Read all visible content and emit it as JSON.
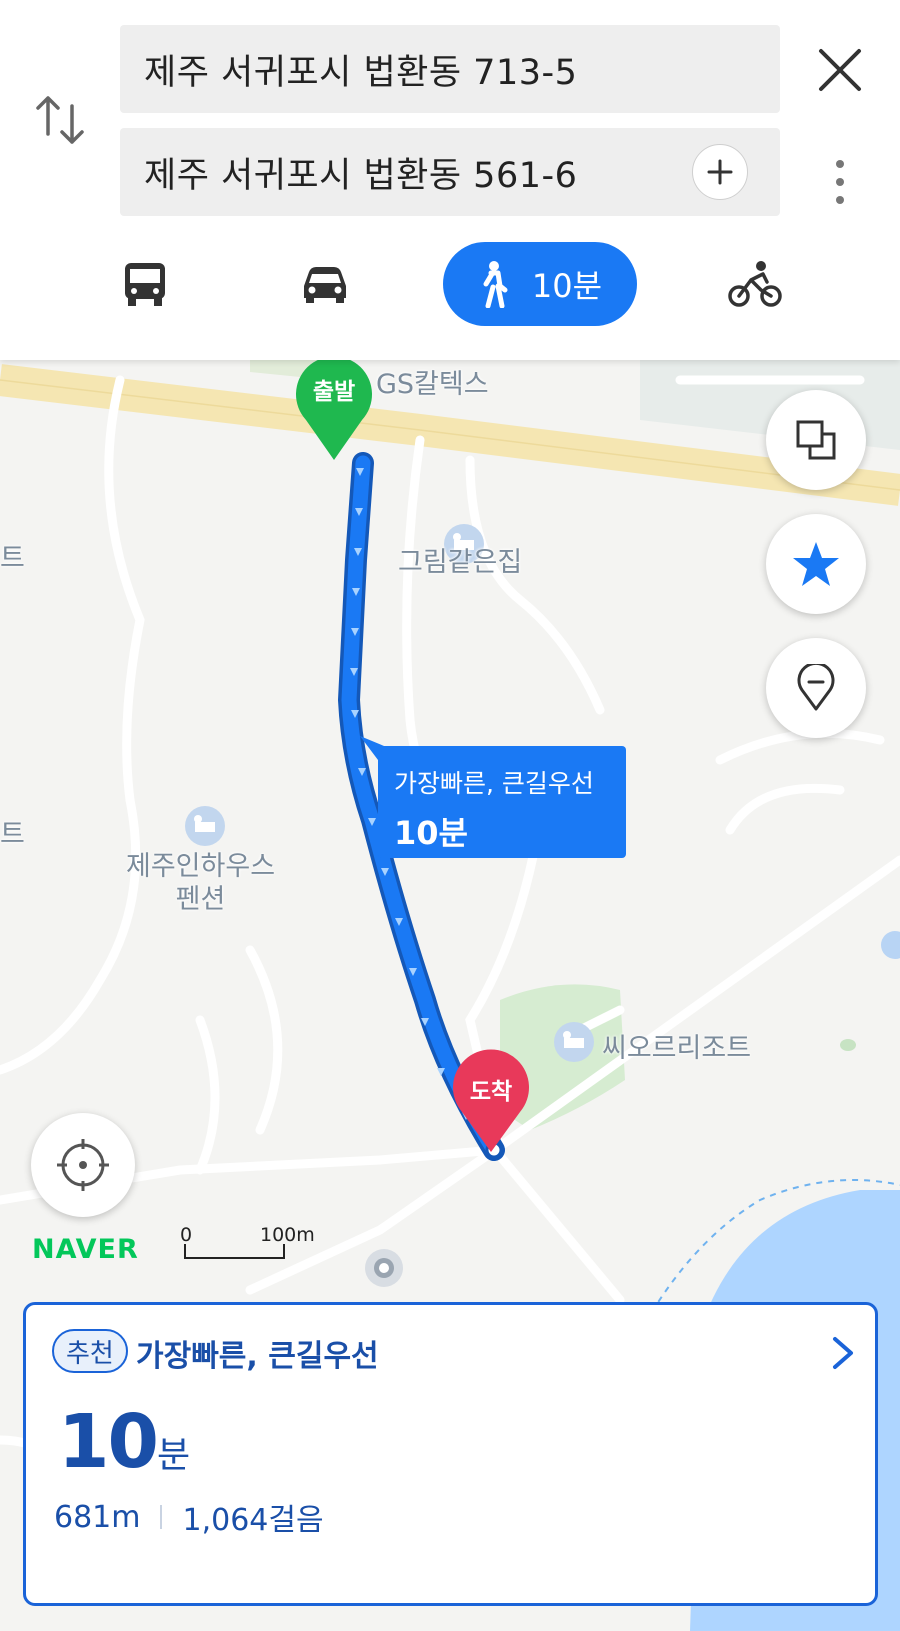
{
  "search": {
    "from_value": "제주 서귀포시 법환동 713-5",
    "to_value": "제주 서귀포시 법환동 561-6"
  },
  "modes": {
    "items": [
      "bus",
      "car",
      "walk",
      "bike"
    ],
    "selected": "walk",
    "walk_time": "10분"
  },
  "map": {
    "labels": {
      "gs": "GS칼텍스",
      "house": "그림같은집",
      "inn": "제주인하우스\n펜션",
      "resort": "씨오르리조트",
      "edge1": "트",
      "edge2": "트"
    },
    "start_marker": "출발",
    "end_marker": "도착",
    "route_bubble_title": "가장빠른, 큰길우선",
    "route_bubble_time": "10분",
    "logo": "NAVER",
    "scale_start": "0",
    "scale_end": "100m",
    "colors": {
      "route": "#1a79f4",
      "start": "#1fb84f",
      "end": "#e8395a",
      "water": "#a9d3ff"
    }
  },
  "route_card": {
    "badge": "추천",
    "title": "가장빠른, 큰길우선",
    "time_value": "10",
    "time_unit": "분",
    "distance": "681m",
    "steps": "1,064걸음"
  },
  "icons": {
    "swap": "swap-arrows-icon",
    "close": "close-icon",
    "add": "plus-icon",
    "more": "more-vertical-icon",
    "bus": "bus-icon",
    "car": "car-icon",
    "walk": "walk-icon",
    "bike": "bike-icon",
    "layers": "layers-icon",
    "star": "star-icon",
    "pin": "location-pin-icon",
    "locate": "current-location-icon"
  }
}
